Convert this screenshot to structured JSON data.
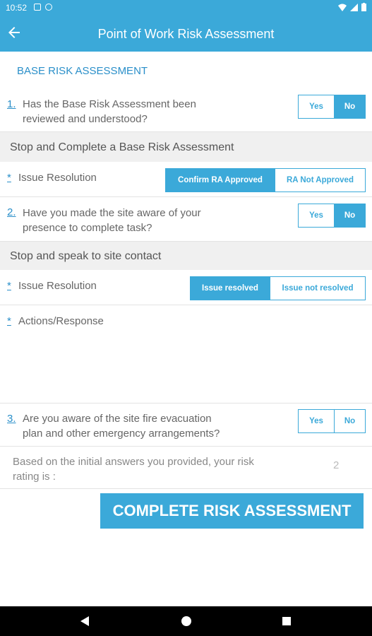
{
  "status_bar": {
    "time": "10:52"
  },
  "app_bar": {
    "title": "Point of Work Risk Assessment"
  },
  "section": {
    "title": "BASE RISK ASSESSMENT"
  },
  "q1": {
    "number": "1.",
    "line1": "Has the Base Risk Assessment been",
    "line2": "reviewed and understood?",
    "yes": "Yes",
    "no": "No",
    "selected": "No"
  },
  "band1": {
    "text": "Stop and Complete a Base Risk Assessment"
  },
  "issue1": {
    "marker": "*",
    "label": "Issue Resolution",
    "opt_a": "Confirm RA Approved",
    "opt_b": "RA Not Approved",
    "selected": "Confirm RA Approved"
  },
  "q2": {
    "number": "2.",
    "line1": "Have you made the site aware of your",
    "line2": "presence to complete task?",
    "yes": "Yes",
    "no": "No",
    "selected": "No"
  },
  "band2": {
    "text": "Stop and speak to site contact"
  },
  "issue2": {
    "marker": "*",
    "label": "Issue Resolution",
    "opt_a": "Issue resolved",
    "opt_b": "Issue not resolved",
    "selected": "Issue resolved"
  },
  "actions": {
    "marker": "*",
    "label": "Actions/Response"
  },
  "q3": {
    "number": "3.",
    "line1": "Are you aware of the site fire evacuation",
    "line2": "plan and other emergency arrangements?",
    "yes": "Yes",
    "no": "No",
    "selected": ""
  },
  "rating": {
    "line1": "Based on the initial answers you provided, your risk",
    "line2": "rating is :",
    "value": "2"
  },
  "cta": {
    "label": "COMPLETE RISK ASSESSMENT"
  },
  "colors": {
    "accent": "#3ba9d9",
    "link": "#2a8fc9",
    "band": "#f0f0f0"
  }
}
